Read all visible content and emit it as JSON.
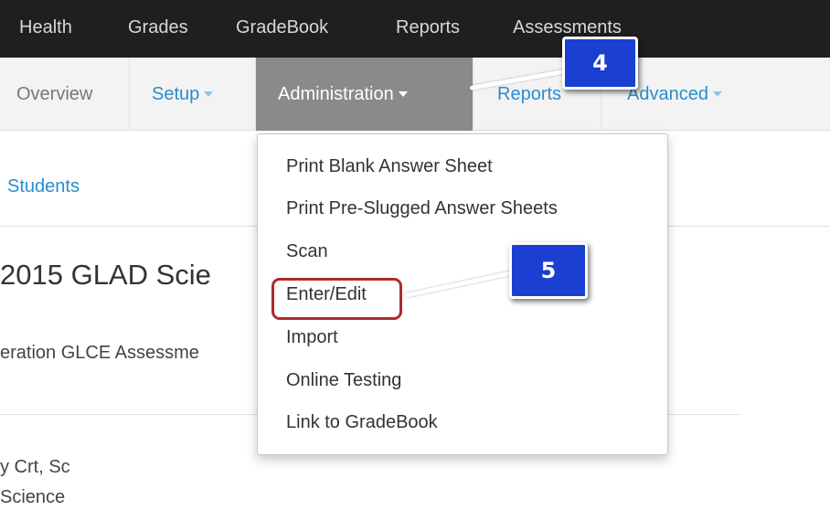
{
  "top_nav": {
    "items": [
      "Health",
      "Grades",
      "GradeBook",
      "Reports",
      "Assessments"
    ]
  },
  "sub_nav": {
    "overview": "Overview",
    "setup": "Setup",
    "administration": "Administration",
    "reports": "Reports",
    "advanced": "Advanced"
  },
  "page": {
    "students_link": "Students",
    "title_fragment": "2015 GLAD Scie",
    "subtitle_fragment": "eration GLCE Assessme",
    "detail_line_1": "y Crt, Sc",
    "detail_line_2": "Science"
  },
  "dropdown": {
    "items": [
      "Print Blank Answer Sheet",
      "Print Pre-Slugged Answer Sheets",
      "Scan",
      "Enter/Edit",
      "Import",
      "Online Testing",
      "Link to GradeBook"
    ]
  },
  "callouts": {
    "step_4": "4",
    "step_5": "5"
  },
  "colors": {
    "top_nav_bg": "#1f1f1f",
    "active_tab_bg": "#8a8a8a",
    "link": "#2a8ccd",
    "badge": "#1a3fd1",
    "highlight": "#b02a2a"
  }
}
